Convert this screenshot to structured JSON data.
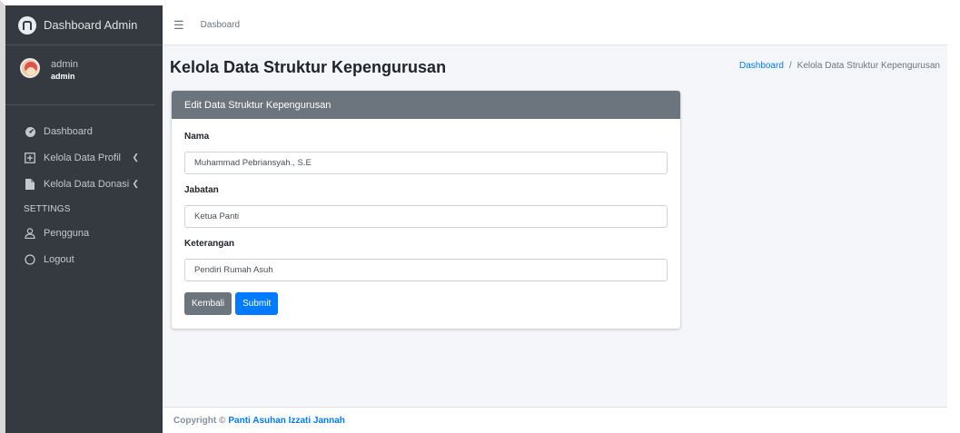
{
  "brand": {
    "title": "Dashboard Admin",
    "logo_icon": "brand-logo-icon"
  },
  "user": {
    "name": "admin",
    "role": "admin"
  },
  "sidebar": {
    "items": [
      {
        "label": "Dashboard",
        "icon": "tachometer-icon"
      },
      {
        "label": "Kelola Data Profil",
        "icon": "plus-square-icon",
        "has_arrow": true
      },
      {
        "label": "Kelola Data Donasi",
        "icon": "file-icon",
        "has_arrow": true
      }
    ],
    "settings_header": "SETTINGS",
    "settings_items": [
      {
        "label": "Pengguna",
        "icon": "user-icon"
      },
      {
        "label": "Logout",
        "icon": "circle-icon"
      }
    ]
  },
  "topbar": {
    "link": "Dasboard"
  },
  "page": {
    "title": "Kelola Data Struktur Kepengurusan",
    "breadcrumb": {
      "home": "Dashboard",
      "separator": "/",
      "current": "Kelola Data Struktur Kepengurusan"
    }
  },
  "form": {
    "header": "Edit Data Struktur Kepengurusan",
    "fields": [
      {
        "label": "Nama",
        "value": "Muhammad Pebriansyah., S.E"
      },
      {
        "label": "Jabatan",
        "value": "Ketua Panti"
      },
      {
        "label": "Keterangan",
        "value": "Pendiri Rumah Asuh"
      }
    ],
    "back_label": "Kembali",
    "submit_label": "Submit"
  },
  "footer": {
    "text": "Copyright ©",
    "link": "Panti Asuhan Izzati Jannah"
  },
  "colors": {
    "sidebar": "#343a40",
    "primary": "#007bff",
    "secondary": "#6c757d",
    "content_bg": "#f4f6f9"
  }
}
